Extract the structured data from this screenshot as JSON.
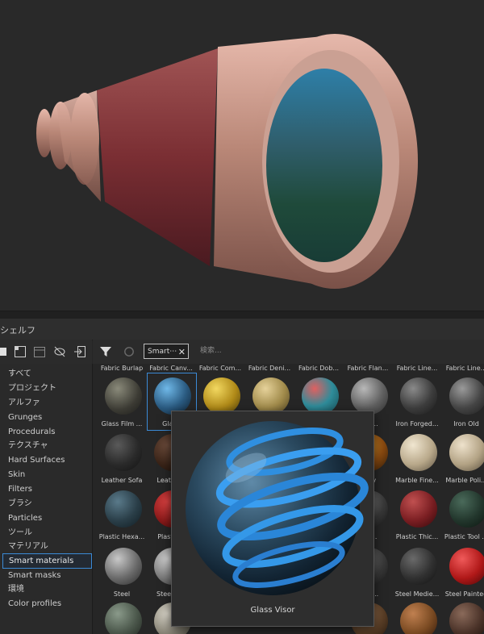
{
  "shelf": {
    "title": "シェルフ"
  },
  "sidebar": {
    "items": [
      {
        "label": "すべて"
      },
      {
        "label": "プロジェクト"
      },
      {
        "label": "アルファ"
      },
      {
        "label": "Grunges"
      },
      {
        "label": "Procedurals"
      },
      {
        "label": "テクスチャ"
      },
      {
        "label": "Hard Surfaces"
      },
      {
        "label": "Skin"
      },
      {
        "label": "Filters"
      },
      {
        "label": "ブラシ"
      },
      {
        "label": "Particles"
      },
      {
        "label": "ツール"
      },
      {
        "label": "マテリアル"
      },
      {
        "label": "Smart materials",
        "selected": true
      },
      {
        "label": "Smart masks"
      },
      {
        "label": "環境"
      },
      {
        "label": "Color profiles"
      }
    ]
  },
  "filter_bar": {
    "tag_label": "Smart⋯",
    "tag_close": "✕",
    "search_placeholder": "検索..."
  },
  "grid": {
    "row0_labels": [
      "Fabric Burlap",
      "Fabric Canv...",
      "Fabric Com...",
      "Fabric Deni...",
      "Fabric Dob...",
      "Fabric Flan...",
      "Fabric Line...",
      "Fabric Line..."
    ],
    "row1_labels": [
      "Glass Film ...",
      "Glass",
      "",
      "",
      "",
      "...ag...",
      "Iron Forged...",
      "Iron Old"
    ],
    "row2_labels": [
      "Leather Sofa",
      "Leathe...",
      "",
      "",
      "",
      "...ery",
      "Marble Fine...",
      "Marble Poli..."
    ],
    "row3_labels": [
      "Plastic Hexa...",
      "Plastic...",
      "",
      "",
      "",
      "...er...",
      "Plastic Thic...",
      "Plastic Tool ..."
    ],
    "row4_labels": [
      "Steel",
      "Steel B...",
      "",
      "",
      "",
      "...n P...",
      "Steel Medie...",
      "Steel Painted"
    ]
  },
  "preview": {
    "label": "Glass Visor"
  }
}
